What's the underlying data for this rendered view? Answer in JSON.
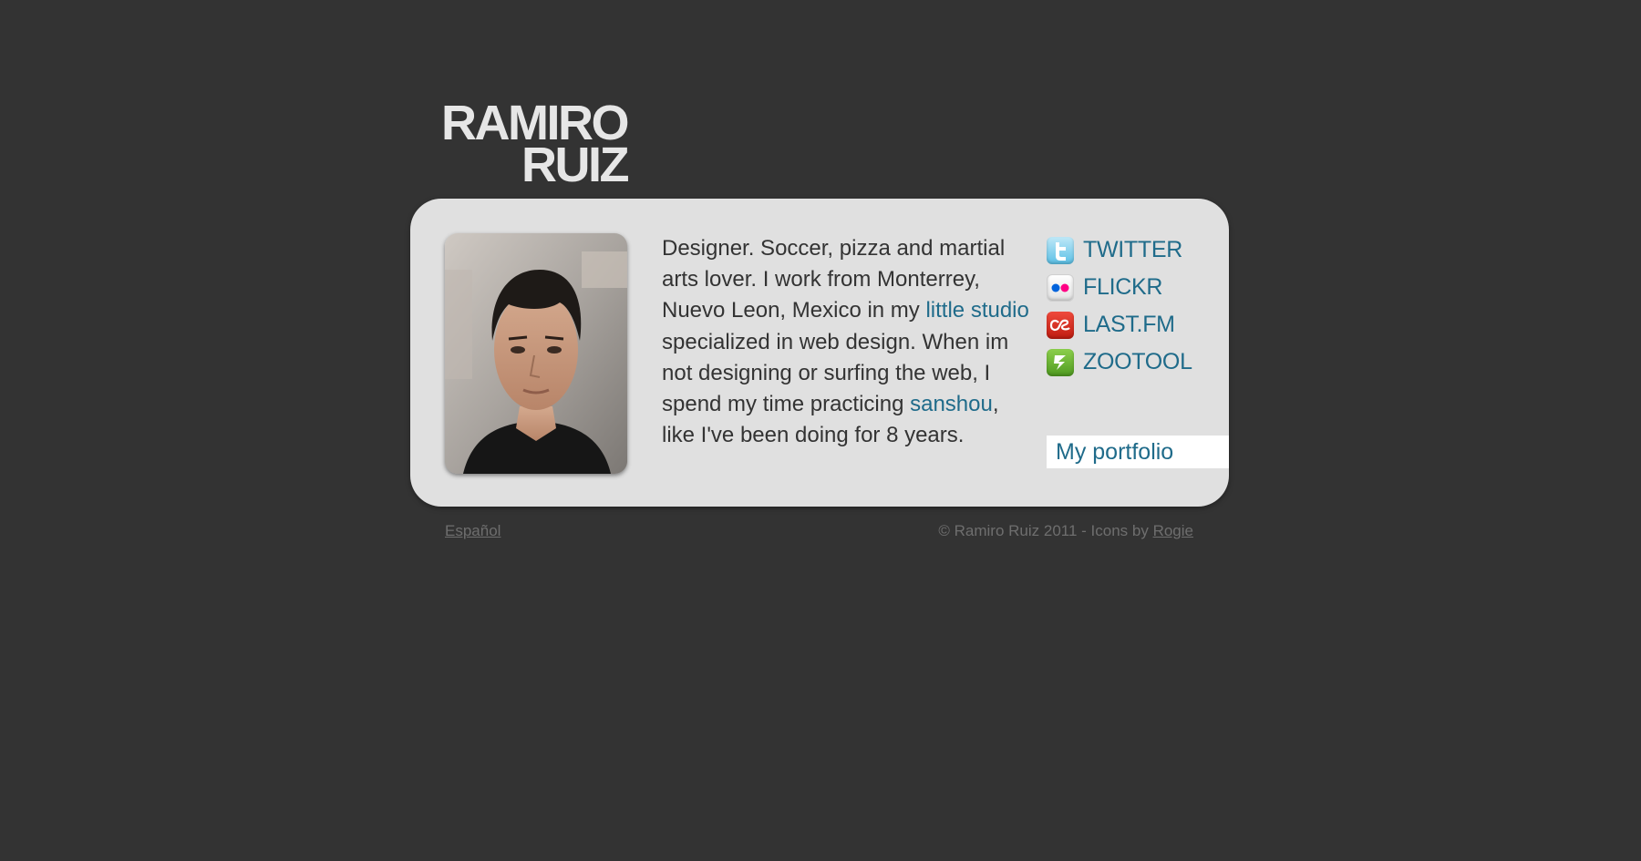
{
  "logo": {
    "line1": "RAMIRO",
    "line2": "RUIZ"
  },
  "bio": {
    "part1": "Designer. Soccer, pizza and martial arts lover. I work from Monterrey, Nuevo Leon, Mexico in my ",
    "link1": "little studio",
    "part2": " specialized in web design. When im not designing or surfing the web, I spend my time practicing ",
    "link2": "sanshou",
    "part3": ", like I've been doing for 8 years."
  },
  "social": [
    {
      "label": "TWITTER",
      "icon": "twitter-icon"
    },
    {
      "label": "FLICKR",
      "icon": "flickr-icon"
    },
    {
      "label": "LAST.FM",
      "icon": "lastfm-icon"
    },
    {
      "label": "ZOOTOOL",
      "icon": "zootool-icon"
    }
  ],
  "portfolio_label": "My portfolio",
  "footer": {
    "language_link": "Español",
    "copyright": "© Ramiro Ruiz 2011 - Icons by ",
    "credit_link": "Rogie"
  },
  "colors": {
    "background": "#333333",
    "card": "#e0e0e0",
    "link": "#1f6b8a"
  }
}
